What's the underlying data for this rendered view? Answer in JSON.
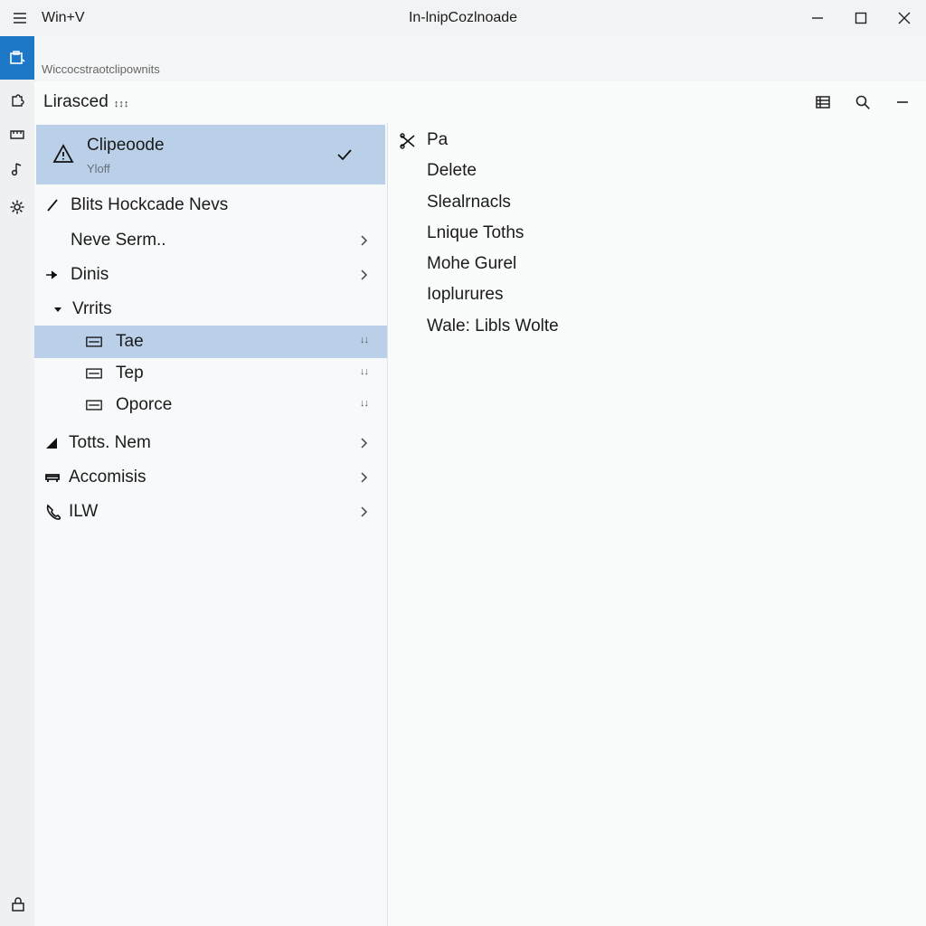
{
  "titlebar": {
    "shortcut": "Win+V",
    "title": "In-lnipCozlnoade",
    "icons": [
      "menu-icon",
      "minimize-icon",
      "maximize-icon",
      "close-icon"
    ]
  },
  "subtitle": "Wiccocstraotclipownits",
  "header": {
    "title": "Lirasced",
    "suffix": "↕↕↕",
    "icons": [
      "list-icon",
      "search-icon",
      "minus-icon"
    ]
  },
  "rail": {
    "icons": [
      "clipboard-icon",
      "puzzle-icon",
      "keyboard-icon",
      "music-icon",
      "gear-icon",
      "lock-icon"
    ],
    "accent": "#1e78c8"
  },
  "list": {
    "selected_card": {
      "title": "Clipeoode",
      "subtitle": "Yloff"
    },
    "items": [
      {
        "label": "Blits Hockcade Nevs",
        "icon": "pencil-icon",
        "chevron": false
      },
      {
        "label": "Neve Serm..",
        "icon": "",
        "chevron": true
      },
      {
        "label": "Dinis",
        "icon": "arrow-right-icon",
        "chevron": true
      },
      {
        "label": "Vrrits",
        "icon": "caret-down-icon",
        "chevron": false
      },
      {
        "label": "Tae",
        "icon": "keyboard-icon",
        "mini": "↓↓",
        "selected": true
      },
      {
        "label": "Tep",
        "icon": "keyboard-icon",
        "mini": "↓↓"
      },
      {
        "label": "Oporce",
        "icon": "keyboard-icon",
        "mini": "↓↓"
      },
      {
        "label": "Totts. Nem",
        "icon": "triangle-icon",
        "chevron": true
      },
      {
        "label": "Accomisis",
        "icon": "sofa-icon",
        "chevron": true
      },
      {
        "label": "ILW",
        "icon": "phone-icon",
        "chevron": true
      }
    ]
  },
  "detail": {
    "items": [
      "Pa",
      "Delete",
      "Slealrnacls",
      "Lnique Toths",
      "Mohe Gurel",
      "Ioplurures",
      "Wale: Libls Wolte"
    ],
    "first_icon": "cut-icon"
  },
  "colors": {
    "selection": "#b9d0e8",
    "accent": "#1e78c8"
  }
}
